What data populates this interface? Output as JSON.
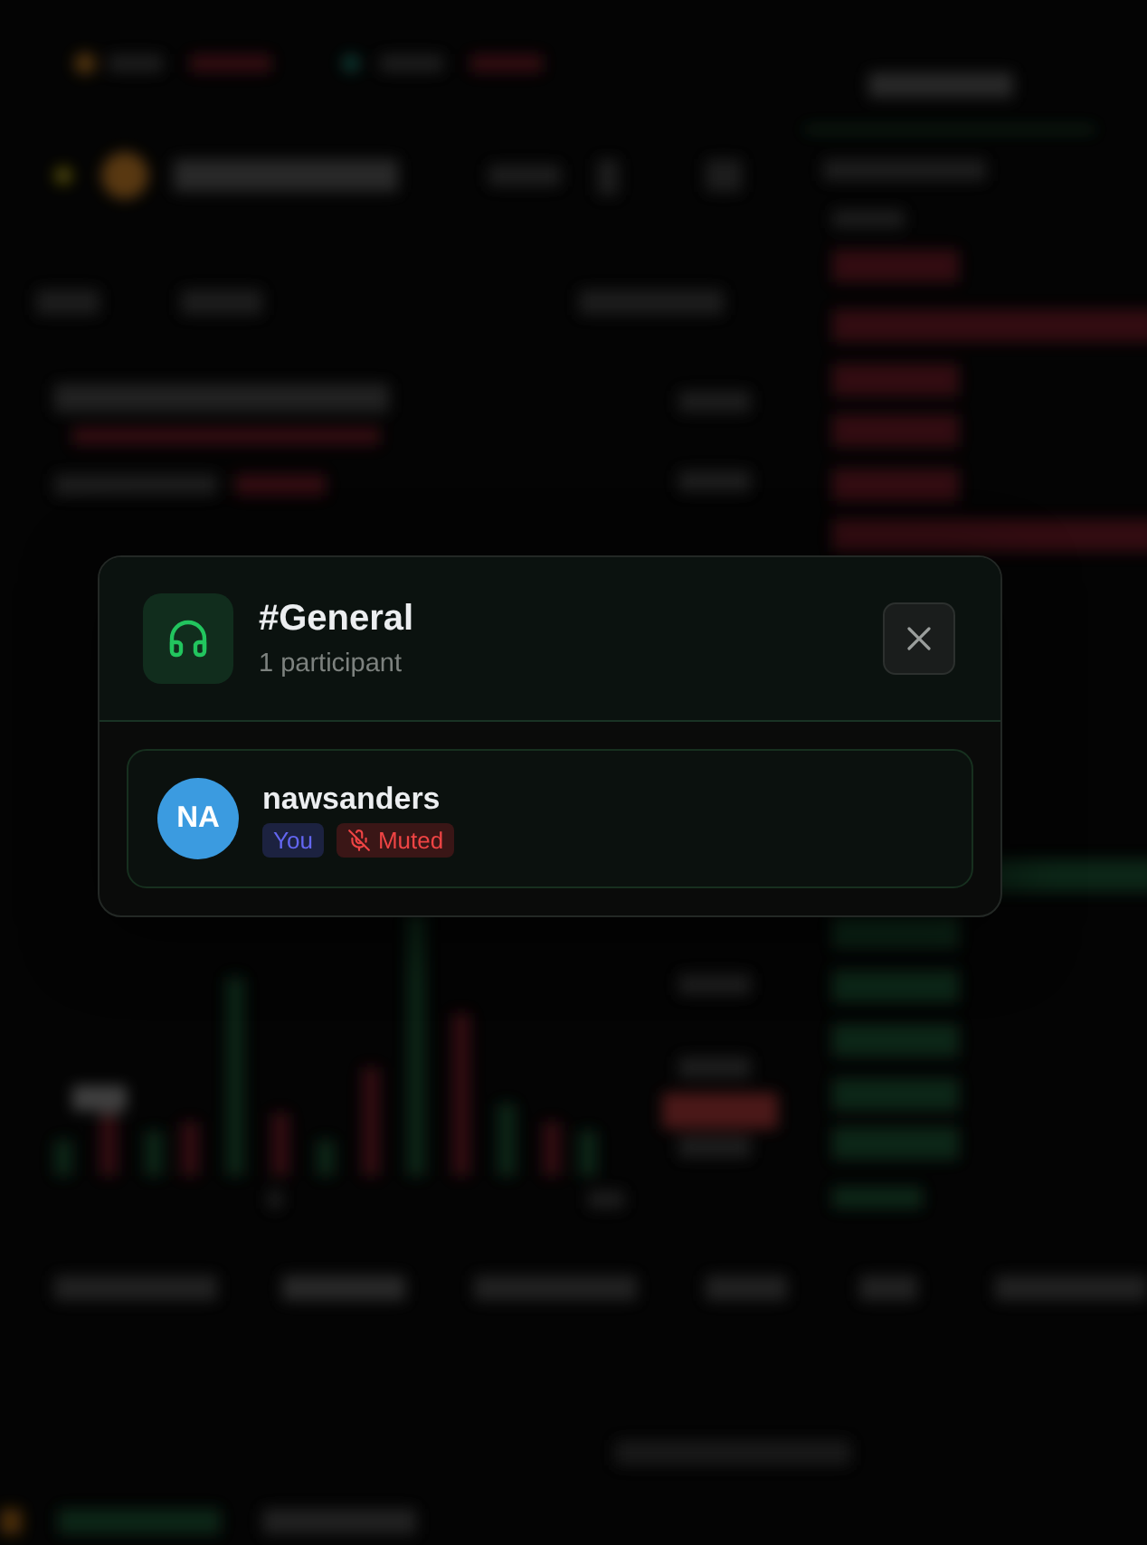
{
  "channel": {
    "name": "#General",
    "participants_label": "1 participant"
  },
  "participants": [
    {
      "initials": "NA",
      "name": "nawsanders",
      "color": "#3b9be0",
      "badges": [
        {
          "kind": "you",
          "label": "You"
        },
        {
          "kind": "muted",
          "label": "Muted"
        }
      ]
    }
  ]
}
